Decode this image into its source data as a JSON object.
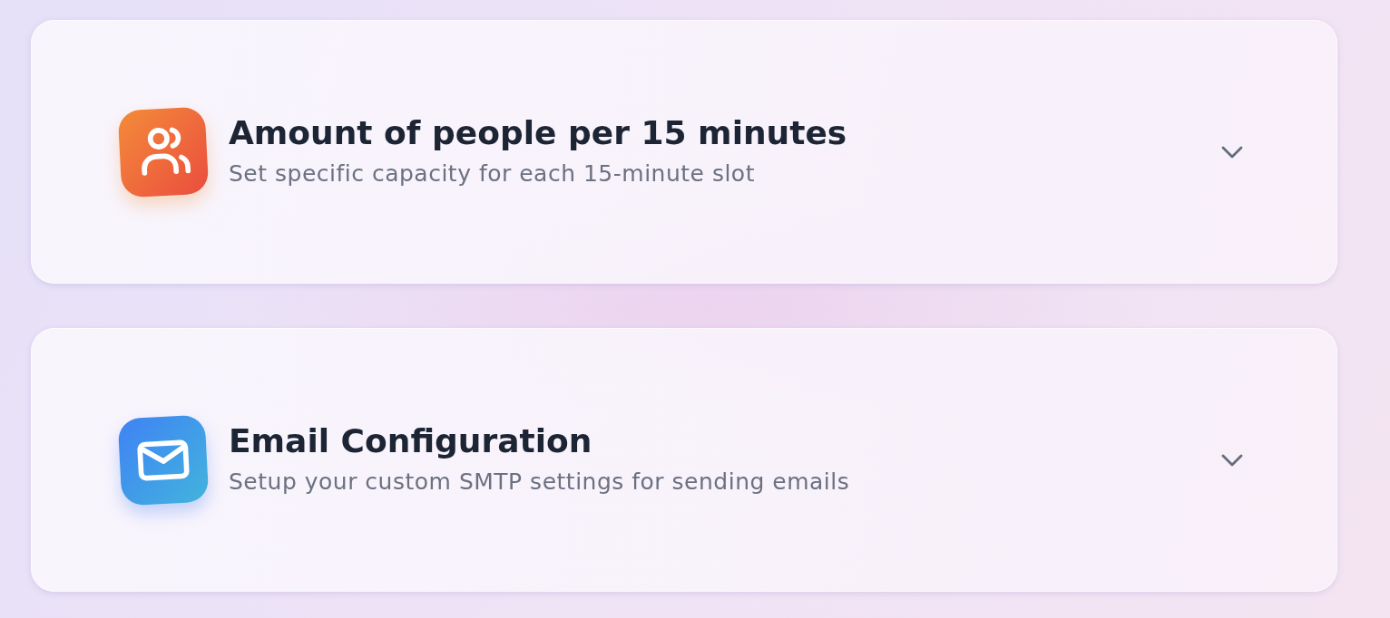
{
  "sections": [
    {
      "kind": "people",
      "title": "Amount of people per 15 minutes",
      "subtitle": "Set specific capacity for each 15-minute slot",
      "expanded": false
    },
    {
      "kind": "mail",
      "title": "Email Configuration",
      "subtitle": "Setup your custom SMTP settings for sending emails",
      "expanded": false
    }
  ]
}
